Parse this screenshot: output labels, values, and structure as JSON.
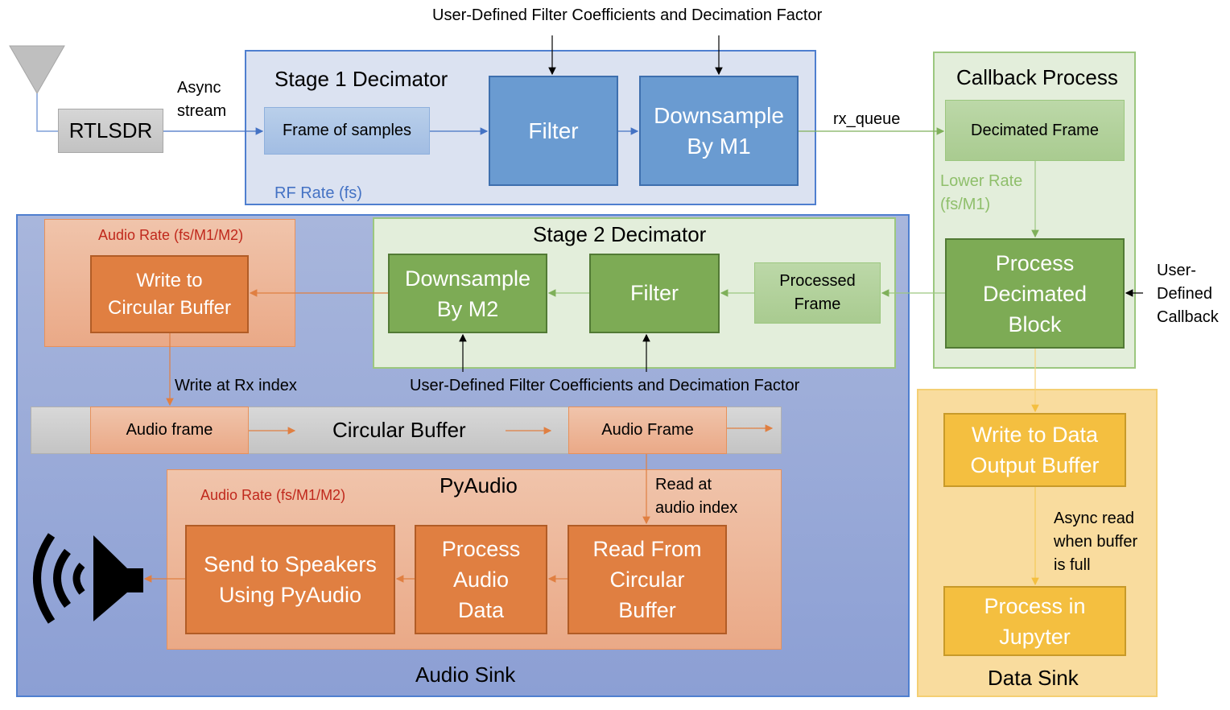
{
  "top_annotation": "User-Defined Filter Coefficients and Decimation Factor",
  "antenna": {
    "icon": "antenna-icon"
  },
  "rtlsdr": {
    "label": "RTLSDR"
  },
  "async_stream": "Async\nstream",
  "stage1": {
    "title": "Stage 1 Decimator",
    "frame_of_samples": "Frame of samples",
    "filter": "Filter",
    "downsample": "Downsample\nBy M1",
    "rate_label": "RF Rate (fs)"
  },
  "rx_queue": "rx_queue",
  "callback": {
    "title": "Callback Process",
    "decimated_frame": "Decimated Frame",
    "lower_rate": "Lower Rate\n(fs/M1)",
    "process_block": "Process\nDecimated\nBlock",
    "user_callback": "User-\nDefined\nCallback"
  },
  "audio_sink": {
    "title": "Audio Sink",
    "audio_rate_top": "Audio Rate (fs/M1/M2)",
    "write_circular": "Write to\nCircular Buffer",
    "write_at_rx": "Write  at Rx index",
    "stage2": {
      "title": "Stage 2 Decimator",
      "downsample": "Downsample\nBy M2",
      "filter": "Filter",
      "processed_frame": "Processed\nFrame",
      "user_defined": "User-Defined Filter Coefficients and Decimation Factor"
    },
    "circular_buffer": {
      "label": "Circular Buffer",
      "audio_frame_in": "Audio frame",
      "audio_frame_out": "Audio Frame"
    },
    "pyaudio": {
      "title": "PyAudio",
      "audio_rate": "Audio Rate (fs/M1/M2)",
      "read_at": "Read  at\naudio index",
      "send_speakers": "Send to Speakers\nUsing PyAudio",
      "process_audio": "Process\nAudio\nData",
      "read_circular": "Read From\nCircular\nBuffer"
    },
    "speaker": {
      "icon": "speaker-icon"
    }
  },
  "data_sink": {
    "title": "Data Sink",
    "write_output": "Write to Data\nOutput Buffer",
    "async_read": "Async read\nwhen buffer\nis full",
    "process_jupyter": "Process in\nJupyter"
  },
  "colors": {
    "stage1_fill": "#dbe2f1",
    "blue_block": "#6a9bd1",
    "green_block": "#7dab55",
    "orange_block": "#e07f41",
    "yellow_block": "#f4bf40",
    "audio_sink_fill": "#9aaad8",
    "data_sink_fill": "#f9dc9e",
    "rate_text_red": "#c0281c",
    "rate_text_blue": "#4472c4",
    "rate_text_green": "#8fbf6b"
  }
}
